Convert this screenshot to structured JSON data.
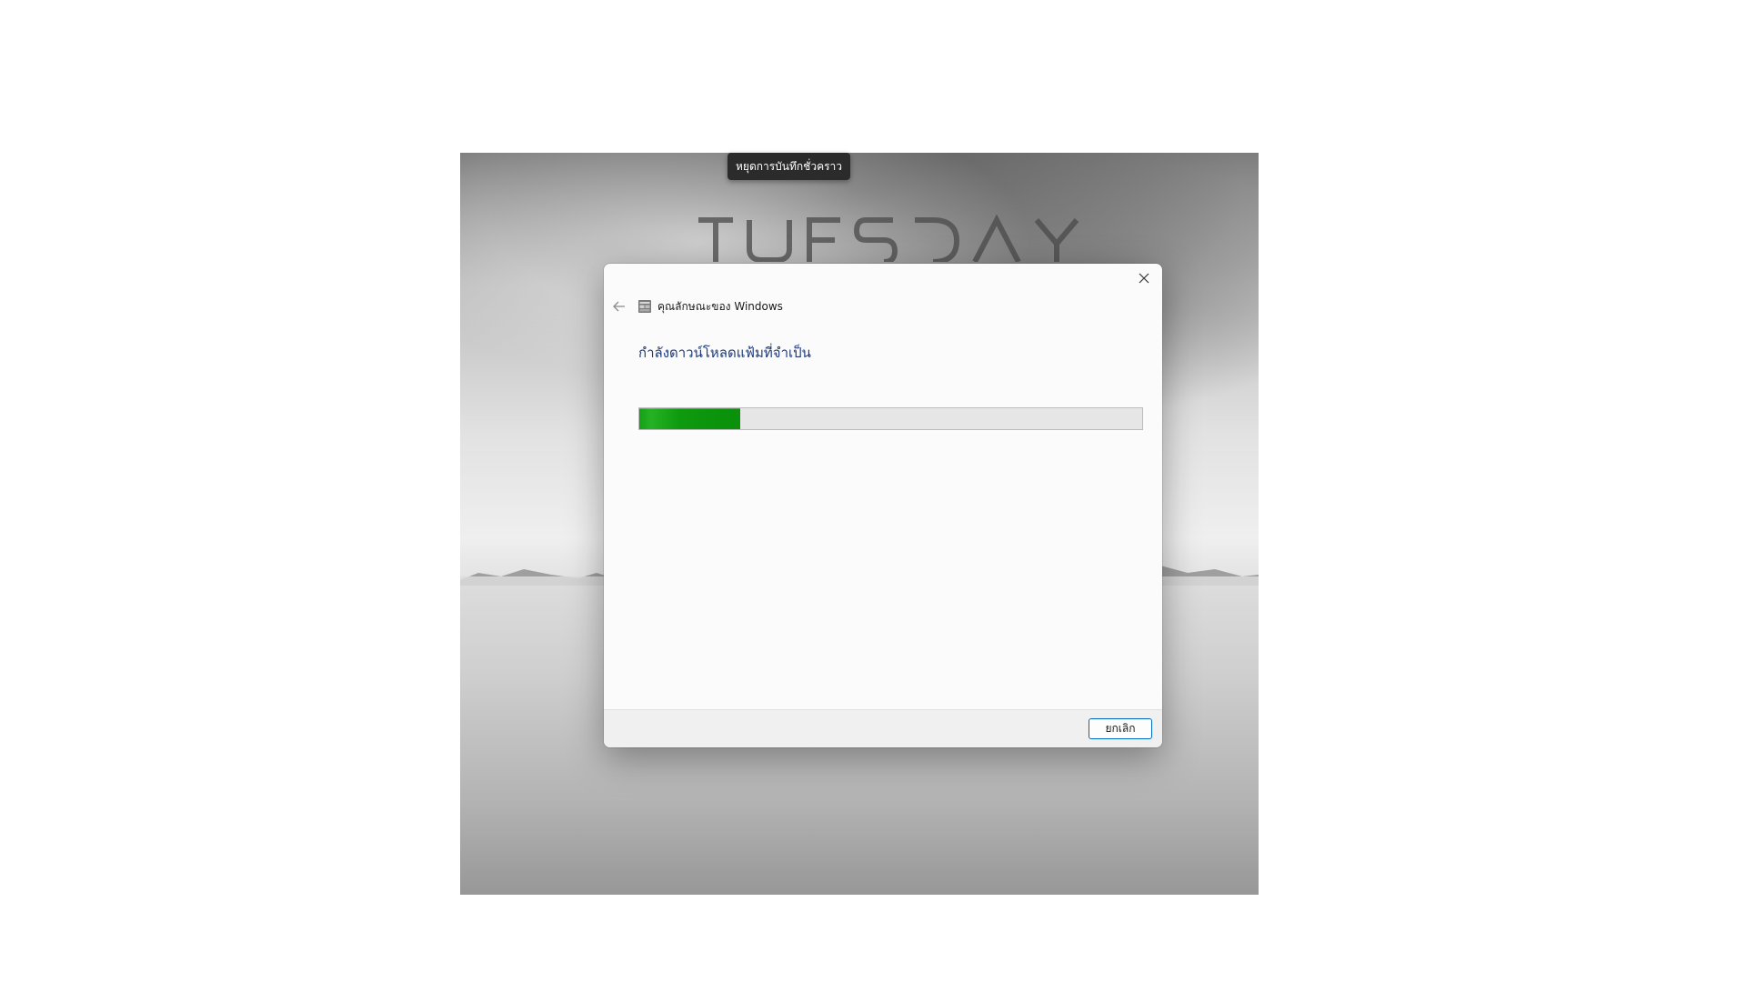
{
  "recording_tooltip": "หยุดการบันทึกชั่วคราว",
  "wallpaper": {
    "logo_text": "TUESDAY"
  },
  "dialog": {
    "title": "คุณลักษณะของ Windows",
    "heading": "กำลังดาวน์โหลดแฟ้มที่จำเป็น",
    "progress_fraction": 0.2,
    "cancel_label": "ยกเลิก",
    "icons": {
      "back": "back-arrow-icon",
      "app": "windows-features-icon",
      "close": "close-icon"
    }
  },
  "colors": {
    "progress_green": "#0e9a0e",
    "heading_blue": "#1e3a7a",
    "button_border": "#0067c0"
  }
}
